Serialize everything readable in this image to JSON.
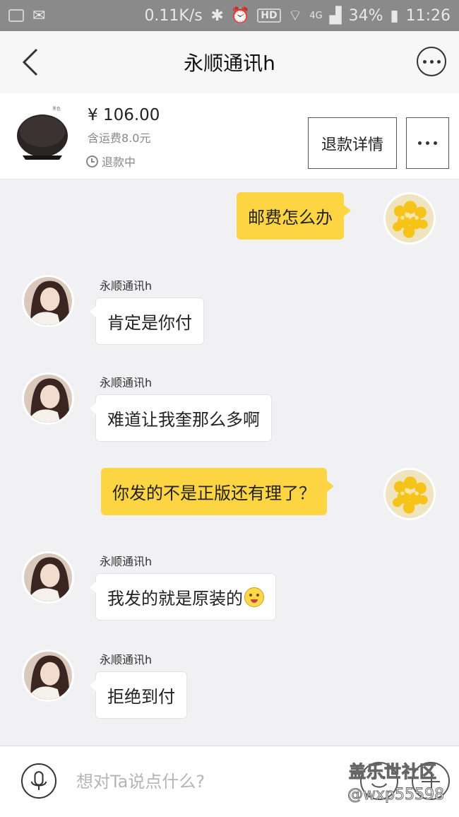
{
  "status_bar": {
    "net_speed": "0.11K/s",
    "hd": "HD",
    "network": "4G",
    "battery": "34%",
    "time": "11:26"
  },
  "header": {
    "title": "永顺通讯h",
    "back_icon": "chevron-left-icon",
    "more_icon": "more-circle-icon"
  },
  "product": {
    "price": "¥ 106.00",
    "shipping": "含运费8.0元",
    "status": "退款中",
    "refund_button": "退款详情",
    "more_button": "more-icon"
  },
  "messages": [
    {
      "from": "me",
      "text": "邮费怎么办"
    },
    {
      "from": "other",
      "sender": "永顺通讯h",
      "text": "肯定是你付"
    },
    {
      "from": "other",
      "sender": "永顺通讯h",
      "text": "难道让我奎那么多啊"
    },
    {
      "from": "me",
      "text": "你发的不是正版还有理了？"
    },
    {
      "from": "other",
      "sender": "永顺通讯h",
      "text": "我发的就是原装的",
      "emoji": "smile-icon"
    },
    {
      "from": "other",
      "sender": "永顺通讯h",
      "text": "拒绝到付"
    }
  ],
  "input": {
    "placeholder": "想对Ta说点什么?",
    "mic_icon": "microphone-icon",
    "emoji_icon": "emoji-icon",
    "plus_icon": "plus-icon"
  },
  "watermark": {
    "line1": "盖乐世社区",
    "line2": "@wxp55598"
  },
  "colors": {
    "accent_bubble": "#fdd442",
    "background": "#f1f1f3"
  }
}
